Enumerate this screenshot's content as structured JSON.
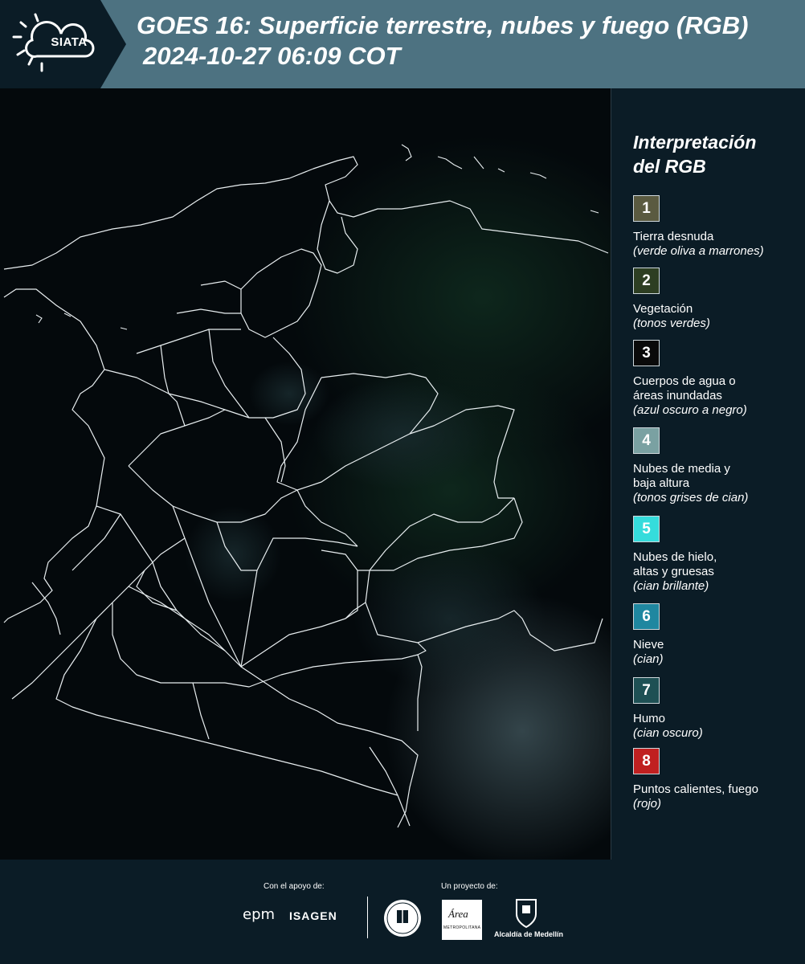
{
  "header": {
    "logo_text": "SIATA",
    "title": "GOES 16: Superficie terrestre, nubes y fuego (RGB)",
    "subtitle": "2024-10-27 06:09 COT"
  },
  "legend": {
    "title_line1": "Interpretación",
    "title_line2": "del RGB",
    "items": [
      {
        "number": "1",
        "color": "#5a5a40",
        "lines": [
          "Tierra desnuda"
        ],
        "desc": "(verde oliva a marrones)"
      },
      {
        "number": "2",
        "color": "#2d3e22",
        "lines": [
          "Vegetación"
        ],
        "desc": "(tonos verdes)"
      },
      {
        "number": "3",
        "color": "#0a0a0a",
        "lines": [
          "Cuerpos de agua o",
          "áreas inundadas"
        ],
        "desc": "(azul oscuro a negro)"
      },
      {
        "number": "4",
        "color": "#7aa1a2",
        "lines": [
          "Nubes de media y",
          "baja altura"
        ],
        "desc": "(tonos grises de cian)"
      },
      {
        "number": "5",
        "color": "#35dcdc",
        "lines": [
          "Nubes de hielo,",
          "altas y gruesas"
        ],
        "desc": "(cian brillante)"
      },
      {
        "number": "6",
        "color": "#1f87a0",
        "lines": [
          "Nieve"
        ],
        "desc": "(cian)"
      },
      {
        "number": "7",
        "color": "#1e5054",
        "lines": [
          "Humo"
        ],
        "desc": "(cian oscuro)"
      },
      {
        "number": "8",
        "color": "#c02020",
        "lines": [
          "Puntos calientes, fuego"
        ],
        "desc": "(rojo)"
      }
    ]
  },
  "footer": {
    "support_label": "Con el apoyo de:",
    "project_label": "Un proyecto de:",
    "sponsor1": "epm",
    "sponsor2": "ISAGEN",
    "area_word": "Área",
    "area_sub": "METROPOLITANA",
    "medellin": "Alcaldía de Medellín"
  }
}
